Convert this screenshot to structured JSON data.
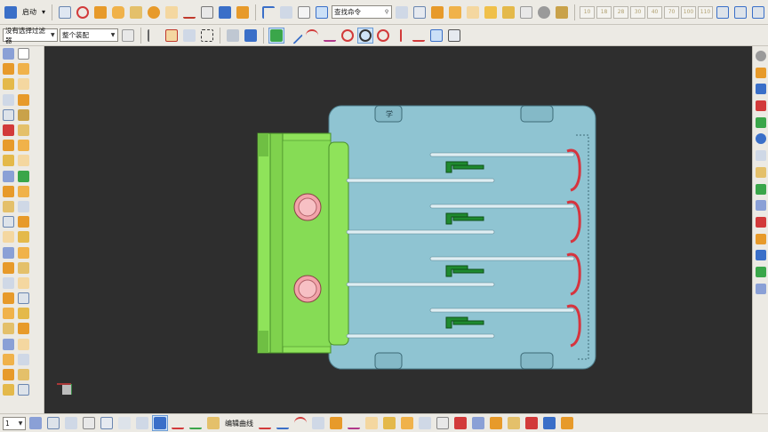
{
  "toolbar": {
    "start_label": "启动",
    "command_search_placeholder": "查找命令",
    "number_buttons": [
      "10",
      "18",
      "28",
      "30",
      "40",
      "70",
      "100",
      "110"
    ]
  },
  "selection_bar": {
    "filter_value": "没有选择过滤器",
    "assembly_value": "整个装配"
  },
  "bottom_bar": {
    "layer_value": "1",
    "edit_curve_label": "编辑曲线"
  },
  "viewport": {
    "background": "#2e2e2e",
    "plate_color": "#8fc4d2",
    "slide_color": "#8fe35a",
    "runner_color": "#1f8a2f",
    "pin_color": "#f2a4aa",
    "stop_color": "#d6343e",
    "plate_label": "学"
  },
  "colors": {
    "toolbar_bg": "#eceae4",
    "accent_blue": "#3a6fc8",
    "accent_orange": "#e79a2a",
    "accent_red": "#d23a3a",
    "accent_green": "#3aa64a"
  }
}
